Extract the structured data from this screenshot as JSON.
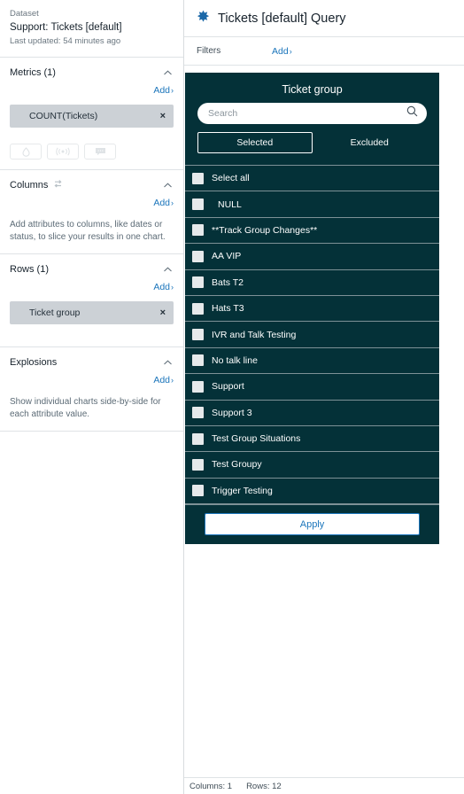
{
  "left": {
    "dataset": {
      "label": "Dataset",
      "title": "Support: Tickets [default]",
      "updated": "Last updated: 54 minutes ago"
    },
    "metrics": {
      "title": "Metrics (1)",
      "add_label": "Add",
      "chips": [
        {
          "label": "COUNT(Tickets)",
          "remove": "×"
        }
      ],
      "icon_buttons": [
        {
          "name": "droplet-icon"
        },
        {
          "name": "broadcast-icon"
        },
        {
          "name": "chat-bubble-icon"
        }
      ]
    },
    "columns": {
      "title": "Columns",
      "add_label": "Add",
      "helper": "Add attributes to columns, like dates or status, to slice your results in one chart."
    },
    "rows": {
      "title": "Rows (1)",
      "add_label": "Add",
      "chips": [
        {
          "label": "Ticket group",
          "remove": "×"
        }
      ]
    },
    "explosions": {
      "title": "Explosions",
      "add_label": "Add",
      "helper": "Show individual charts side-by-side for each attribute value."
    }
  },
  "right": {
    "header": {
      "icon": "star-burst-icon",
      "title": "Tickets [default] Query"
    },
    "filters_bar": {
      "label": "Filters",
      "add_label": "Add"
    },
    "popover": {
      "title": "Ticket group",
      "search_placeholder": "Search",
      "search_value": "",
      "search_icon": "search-icon",
      "tabs": [
        {
          "label": "Selected",
          "active": true
        },
        {
          "label": "Excluded",
          "active": false
        }
      ],
      "items": [
        {
          "label": "Select all",
          "checked": false,
          "indent": false
        },
        {
          "label": "NULL",
          "checked": false,
          "indent": true
        },
        {
          "label": "**Track Group Changes**",
          "checked": false,
          "indent": false
        },
        {
          "label": "AA VIP",
          "checked": false,
          "indent": false
        },
        {
          "label": "Bats T2",
          "checked": false,
          "indent": false
        },
        {
          "label": "Hats T3",
          "checked": false,
          "indent": false
        },
        {
          "label": "IVR and Talk Testing",
          "checked": false,
          "indent": false
        },
        {
          "label": "No talk line",
          "checked": false,
          "indent": false
        },
        {
          "label": "Support",
          "checked": false,
          "indent": false
        },
        {
          "label": "Support 3",
          "checked": false,
          "indent": false
        },
        {
          "label": "Test Group Situations",
          "checked": false,
          "indent": false
        },
        {
          "label": "Test Groupy",
          "checked": false,
          "indent": false
        },
        {
          "label": "Trigger Testing",
          "checked": false,
          "indent": false
        }
      ],
      "apply_label": "Apply"
    },
    "status": {
      "columns": "Columns: 1",
      "rows": "Rows: 12"
    }
  },
  "colors": {
    "popover_bg": "#043138",
    "link_blue": "#1b75bb",
    "chip_gray": "#ccd1d6",
    "text_dark": "#16212b"
  }
}
